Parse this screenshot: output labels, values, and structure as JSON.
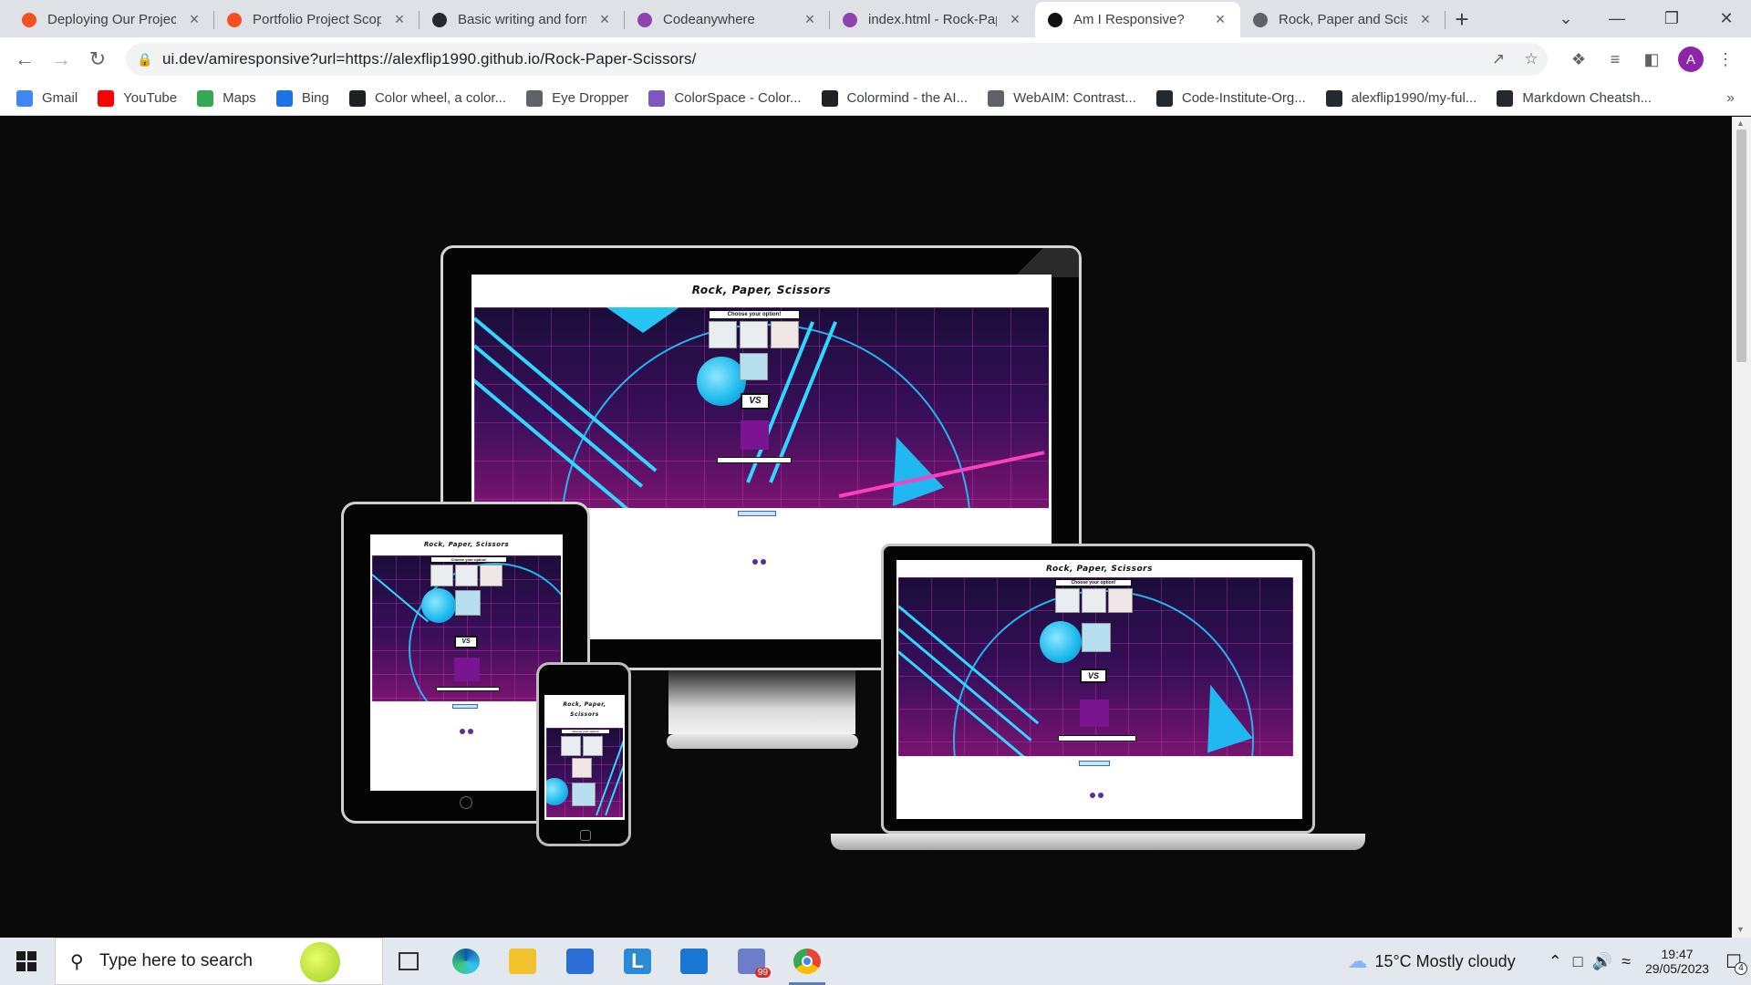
{
  "browser": {
    "tabs": [
      {
        "title": "Deploying Our Project",
        "icon": "codeinstitute-icon",
        "color": "#f4511e",
        "active": false
      },
      {
        "title": "Portfolio Project Scope",
        "icon": "codeinstitute-icon",
        "color": "#f4511e",
        "active": false
      },
      {
        "title": "Basic writing and form",
        "icon": "github-icon",
        "color": "#24292f",
        "active": false
      },
      {
        "title": "Codeanywhere",
        "icon": "codeanywhere-icon",
        "color": "#8e44ad",
        "active": false
      },
      {
        "title": "index.html - Rock-Pap",
        "icon": "codeanywhere-icon",
        "color": "#8e44ad",
        "active": false
      },
      {
        "title": "Am I Responsive?",
        "icon": "uidev-icon",
        "color": "#111111",
        "active": true
      },
      {
        "title": "Rock, Paper and Sciss",
        "icon": "globe-icon",
        "color": "#5f6368",
        "active": false
      }
    ],
    "new_tab_label": "+",
    "url": "ui.dev/amiresponsive?url=https://alexflip1990.github.io/Rock-Paper-Scissors/",
    "profile_initial": "A",
    "bookmarks": [
      {
        "label": "Gmail",
        "icon": "google-icon",
        "color": "#4285f4"
      },
      {
        "label": "YouTube",
        "icon": "youtube-icon",
        "color": "#ff0000"
      },
      {
        "label": "Maps",
        "icon": "maps-icon",
        "color": "#34a853"
      },
      {
        "label": "Bing",
        "icon": "search-icon",
        "color": "#1a73e8"
      },
      {
        "label": "Color wheel, a color...",
        "icon": "canva-icon",
        "color": "#202124"
      },
      {
        "label": "Eye Dropper",
        "icon": "eyedropper-icon",
        "color": "#5f6368"
      },
      {
        "label": "ColorSpace - Color...",
        "icon": "colorspace-icon",
        "color": "#7e57c2"
      },
      {
        "label": "Colormind - the AI...",
        "icon": "colormind-icon",
        "color": "#202124"
      },
      {
        "label": "WebAIM: Contrast...",
        "icon": "webaim-icon",
        "color": "#5f6368"
      },
      {
        "label": "Code-Institute-Org...",
        "icon": "github-icon",
        "color": "#24292f"
      },
      {
        "label": "alexflip1990/my-ful...",
        "icon": "github-icon",
        "color": "#24292f"
      },
      {
        "label": "Markdown Cheatsh...",
        "icon": "github-icon",
        "color": "#24292f"
      }
    ]
  },
  "mockup": {
    "game_title": "Rock, Paper, Scissors",
    "phone_title_line1": "Rock, Paper,",
    "phone_title_line2": "Scissors",
    "choose_label": "Choose your option!",
    "vs_label": "VS",
    "score_text": "Player 0:0 Computer",
    "reset_label": "Restart Game!"
  },
  "taskbar": {
    "search_placeholder": "Type here to search",
    "weather": "15°C  Mostly cloudy",
    "time": "19:47",
    "date": "29/05/2023",
    "notification_count": "4",
    "mail_badge": "99"
  }
}
